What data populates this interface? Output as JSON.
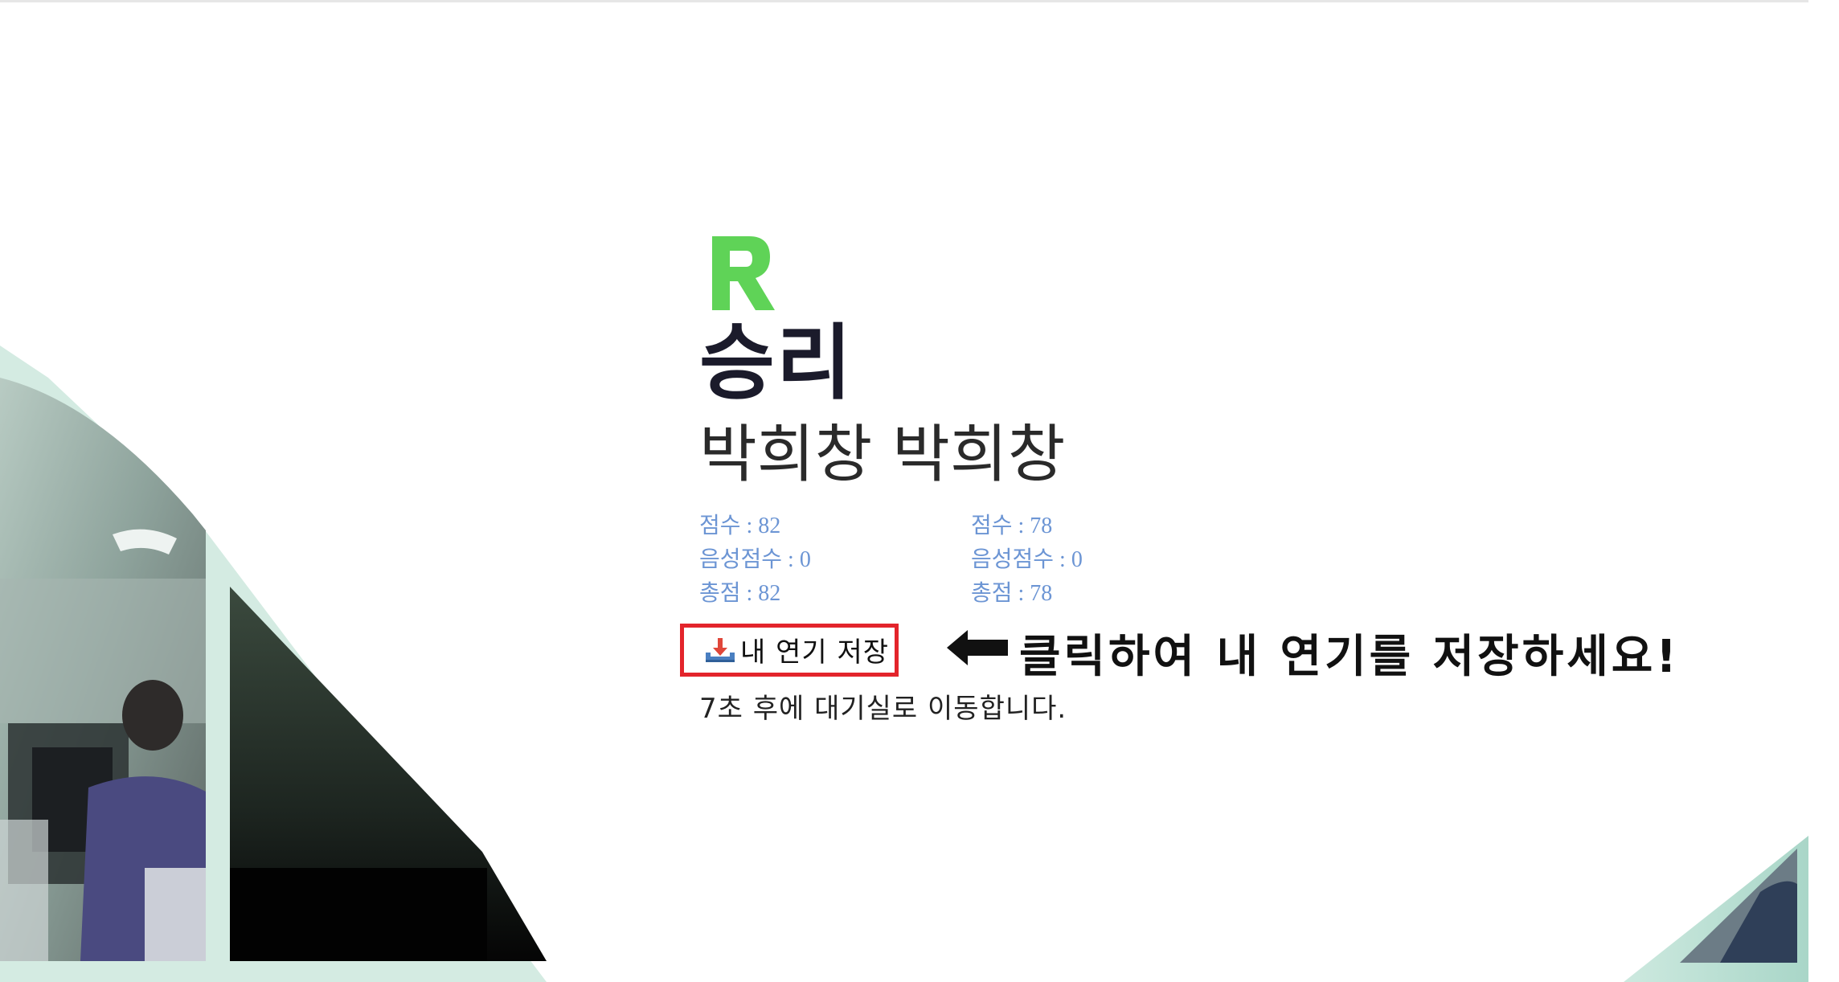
{
  "brand": {
    "logo_icon": "r-logo-icon",
    "logo_color": "#5fd357"
  },
  "result": {
    "title": "승리",
    "players": "박희창 박희창"
  },
  "scores": {
    "player1": {
      "score": "점수 : 82",
      "voice_score": "음성점수 : 0",
      "total": "총점 : 82"
    },
    "player2": {
      "score": "점수 : 78",
      "voice_score": "음성점수 : 0",
      "total": "총점 : 78"
    },
    "text_color": "#6c95d4"
  },
  "actions": {
    "save_label": "내 연기 저장",
    "save_icon": "download-tray-icon",
    "highlight_color": "#e3242b"
  },
  "annotation": {
    "arrow_icon": "left-arrow-icon",
    "hint": "클릭하여 내 연기를 저장하세요!"
  },
  "countdown": "7초 후에 대기실로 이동합니다."
}
